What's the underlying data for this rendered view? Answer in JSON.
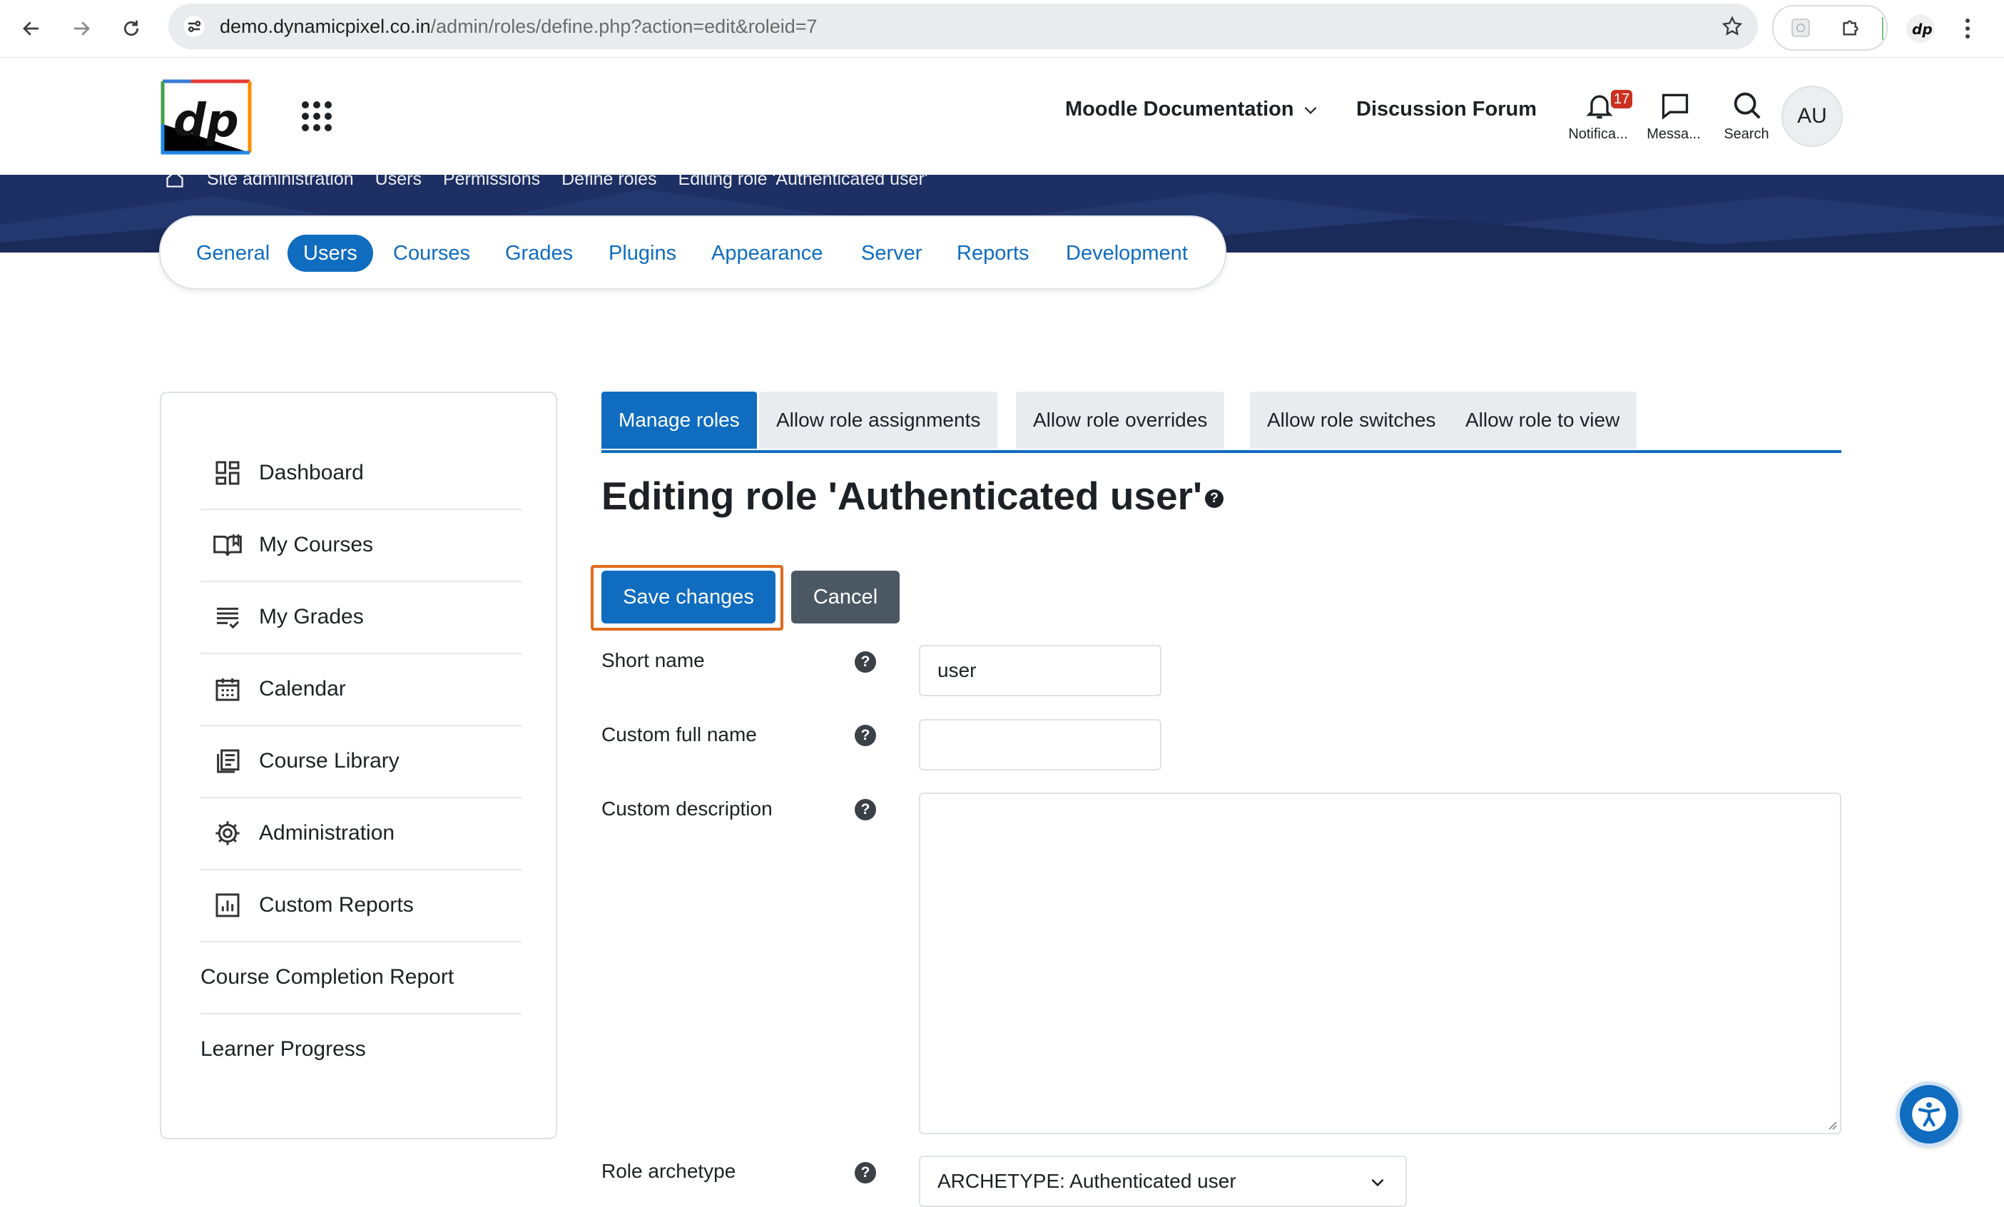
{
  "browser": {
    "url_host": "demo.dynamicpixel.co.in",
    "url_path": "/admin/roles/define.php?action=edit&roleid=7"
  },
  "navbar": {
    "logo_text": "dp",
    "moodle_docs": "Moodle Documentation",
    "forum": "Discussion Forum",
    "notifications_label": "Notifica...",
    "notifications_count": "17",
    "messages_label": "Messa...",
    "search_label": "Search",
    "avatar": "AU"
  },
  "breadcrumb": [
    "Site administration",
    "Users",
    "Permissions",
    "Define roles",
    "Editing role 'Authenticated user'"
  ],
  "secondary_nav": {
    "items": [
      "General",
      "Users",
      "Courses",
      "Grades",
      "Plugins",
      "Appearance",
      "Server",
      "Reports",
      "Development"
    ],
    "active": "Users"
  },
  "left_menu": {
    "items": [
      "Dashboard",
      "My Courses",
      "My Grades",
      "Calendar",
      "Course Library",
      "Administration",
      "Custom Reports",
      "Course Completion Report",
      "Learner Progress"
    ]
  },
  "tabs": {
    "items": [
      "Manage roles",
      "Allow role assignments",
      "Allow role overrides",
      "Allow role switches",
      "Allow role to view"
    ],
    "active": "Manage roles"
  },
  "page": {
    "title": "Editing role 'Authenticated user'"
  },
  "buttons": {
    "save": "Save changes",
    "cancel": "Cancel"
  },
  "form": {
    "short_name_label": "Short name",
    "short_name_value": "user",
    "full_name_label": "Custom full name",
    "full_name_value": "",
    "description_label": "Custom description",
    "archetype_label": "Role archetype",
    "archetype_value": "ARCHETYPE: Authenticated user"
  },
  "colors": {
    "primary": "#0f6cbf",
    "banner": "#1e2f63",
    "secondary_button": "#4b5863",
    "focus_ring": "#e06b1d",
    "badge": "#ca3120"
  }
}
